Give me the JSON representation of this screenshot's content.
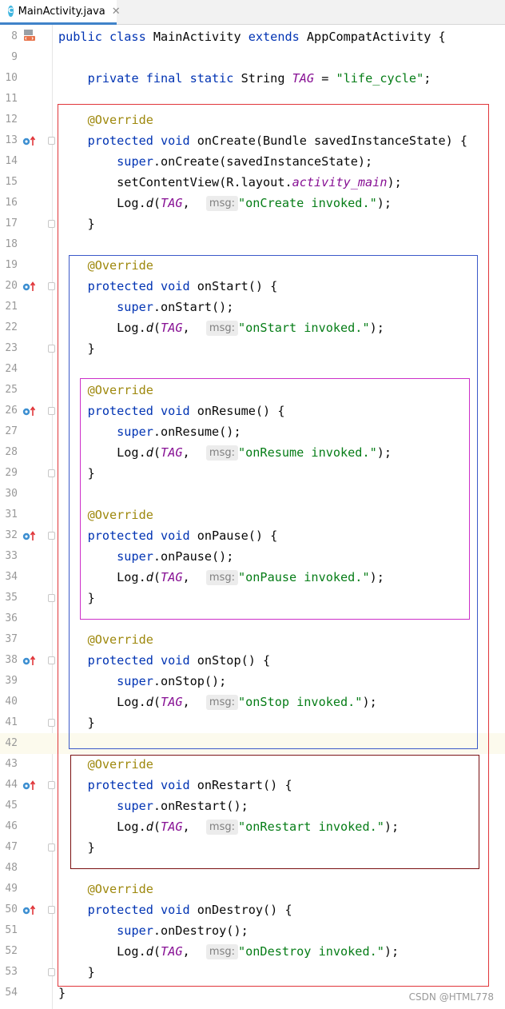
{
  "tab": {
    "icon_letter": "C",
    "filename": "MainActivity.java",
    "close": "✕"
  },
  "watermark": "CSDN @HTML778",
  "colors": {
    "red_box": "#e0363a",
    "blue_box": "#3b59c9",
    "magenta_box": "#cc2fc9",
    "dark_red_box": "#7a0f10"
  },
  "lines": [
    {
      "n": "8",
      "code": [
        [
          "kw",
          "public class "
        ],
        [
          "",
          "MainActivity "
        ],
        [
          "kw",
          "extends "
        ],
        [
          "",
          "AppCompatActivity {"
        ]
      ],
      "marker": "layout"
    },
    {
      "n": "9",
      "code": []
    },
    {
      "n": "10",
      "code": [
        [
          "",
          "    "
        ],
        [
          "kw",
          "private final static "
        ],
        [
          "",
          "String "
        ],
        [
          "fld",
          "TAG"
        ],
        [
          "",
          " = "
        ],
        [
          "str",
          "\"life_cycle\""
        ],
        [
          "",
          ";"
        ]
      ]
    },
    {
      "n": "11",
      "code": []
    },
    {
      "n": "12",
      "code": [
        [
          "",
          "    "
        ],
        [
          "ann",
          "@Override"
        ]
      ]
    },
    {
      "n": "13",
      "code": [
        [
          "",
          "    "
        ],
        [
          "kw",
          "protected void "
        ],
        [
          "",
          "onCreate(Bundle savedInstanceState) {"
        ]
      ],
      "marker": "override",
      "fold": true
    },
    {
      "n": "14",
      "code": [
        [
          "",
          "        "
        ],
        [
          "kw",
          "super"
        ],
        [
          "",
          ".onCreate(savedInstanceState);"
        ]
      ]
    },
    {
      "n": "15",
      "code": [
        [
          "",
          "        "
        ],
        [
          "",
          "setContentView(R.layout."
        ],
        [
          "fld",
          "activity_main"
        ],
        [
          "",
          ");"
        ]
      ]
    },
    {
      "n": "16",
      "code": [
        [
          "",
          "        Log."
        ],
        [
          "st",
          "d"
        ],
        [
          "",
          "("
        ],
        [
          "fld",
          "TAG"
        ],
        [
          "",
          ",  "
        ],
        [
          "hint",
          "msg:"
        ],
        [
          "str",
          "\"onCreate invoked.\""
        ],
        [
          "",
          ");"
        ]
      ]
    },
    {
      "n": "17",
      "code": [
        [
          "",
          "    }"
        ]
      ],
      "fold": true
    },
    {
      "n": "18",
      "code": []
    },
    {
      "n": "19",
      "code": [
        [
          "",
          "    "
        ],
        [
          "ann",
          "@Override"
        ]
      ]
    },
    {
      "n": "20",
      "code": [
        [
          "",
          "    "
        ],
        [
          "kw",
          "protected void "
        ],
        [
          "",
          "onStart() {"
        ]
      ],
      "marker": "override",
      "fold": true
    },
    {
      "n": "21",
      "code": [
        [
          "",
          "        "
        ],
        [
          "kw",
          "super"
        ],
        [
          "",
          ".onStart();"
        ]
      ]
    },
    {
      "n": "22",
      "code": [
        [
          "",
          "        Log."
        ],
        [
          "st",
          "d"
        ],
        [
          "",
          "("
        ],
        [
          "fld",
          "TAG"
        ],
        [
          "",
          ",  "
        ],
        [
          "hint",
          "msg:"
        ],
        [
          "str",
          "\"onStart invoked.\""
        ],
        [
          "",
          ");"
        ]
      ]
    },
    {
      "n": "23",
      "code": [
        [
          "",
          "    }"
        ]
      ],
      "fold": true
    },
    {
      "n": "24",
      "code": []
    },
    {
      "n": "25",
      "code": [
        [
          "",
          "    "
        ],
        [
          "ann",
          "@Override"
        ]
      ]
    },
    {
      "n": "26",
      "code": [
        [
          "",
          "    "
        ],
        [
          "kw",
          "protected void "
        ],
        [
          "",
          "onResume() {"
        ]
      ],
      "marker": "override",
      "fold": true
    },
    {
      "n": "27",
      "code": [
        [
          "",
          "        "
        ],
        [
          "kw",
          "super"
        ],
        [
          "",
          ".onResume();"
        ]
      ]
    },
    {
      "n": "28",
      "code": [
        [
          "",
          "        Log."
        ],
        [
          "st",
          "d"
        ],
        [
          "",
          "("
        ],
        [
          "fld",
          "TAG"
        ],
        [
          "",
          ",  "
        ],
        [
          "hint",
          "msg:"
        ],
        [
          "str",
          "\"onResume invoked.\""
        ],
        [
          "",
          ");"
        ]
      ]
    },
    {
      "n": "29",
      "code": [
        [
          "",
          "    }"
        ]
      ],
      "fold": true
    },
    {
      "n": "30",
      "code": []
    },
    {
      "n": "31",
      "code": []
    },
    {
      "n": "32",
      "code": [
        [
          "",
          "    "
        ],
        [
          "kw",
          "protected void "
        ],
        [
          "",
          "onPause() {"
        ]
      ],
      "marker": "override",
      "fold": true
    },
    {
      "n": "33",
      "code": [
        [
          "",
          "        "
        ],
        [
          "kw",
          "super"
        ],
        [
          "",
          ".onPause();"
        ]
      ]
    },
    {
      "n": "34",
      "code": [
        [
          "",
          "        Log."
        ],
        [
          "st",
          "d"
        ],
        [
          "",
          "("
        ],
        [
          "fld",
          "TAG"
        ],
        [
          "",
          ",  "
        ],
        [
          "hint",
          "msg:"
        ],
        [
          "str",
          "\"onPause invoked.\""
        ],
        [
          "",
          ");"
        ]
      ]
    },
    {
      "n": "35",
      "code": [
        [
          "",
          "    }"
        ]
      ],
      "fold": true
    },
    {
      "n": "36",
      "code": []
    },
    {
      "n": "37",
      "code": [
        [
          "",
          "    "
        ],
        [
          "ann",
          "@Override"
        ]
      ]
    },
    {
      "n": "38",
      "code": [
        [
          "",
          "    "
        ],
        [
          "kw",
          "protected void "
        ],
        [
          "",
          "onStop() {"
        ]
      ],
      "marker": "override",
      "fold": true
    },
    {
      "n": "39",
      "code": [
        [
          "",
          "        "
        ],
        [
          "kw",
          "super"
        ],
        [
          "",
          ".onStop();"
        ]
      ]
    },
    {
      "n": "40",
      "code": [
        [
          "",
          "        Log."
        ],
        [
          "st",
          "d"
        ],
        [
          "",
          "("
        ],
        [
          "fld",
          "TAG"
        ],
        [
          "",
          ",  "
        ],
        [
          "hint",
          "msg:"
        ],
        [
          "str",
          "\"onStop invoked.\""
        ],
        [
          "",
          ");"
        ]
      ]
    },
    {
      "n": "41",
      "code": [
        [
          "",
          "    }"
        ]
      ],
      "fold": true
    },
    {
      "n": "42",
      "code": [],
      "current": true
    },
    {
      "n": "43",
      "code": [
        [
          "",
          "    "
        ],
        [
          "ann",
          "@Override"
        ]
      ]
    },
    {
      "n": "44",
      "code": [
        [
          "",
          "    "
        ],
        [
          "kw",
          "protected void "
        ],
        [
          "",
          "onRestart() {"
        ]
      ],
      "marker": "override",
      "fold": true
    },
    {
      "n": "45",
      "code": [
        [
          "",
          "        "
        ],
        [
          "kw",
          "super"
        ],
        [
          "",
          ".onRestart();"
        ]
      ]
    },
    {
      "n": "46",
      "code": [
        [
          "",
          "        Log."
        ],
        [
          "st",
          "d"
        ],
        [
          "",
          "("
        ],
        [
          "fld",
          "TAG"
        ],
        [
          "",
          ",  "
        ],
        [
          "hint",
          "msg:"
        ],
        [
          "str",
          "\"onRestart invoked.\""
        ],
        [
          "",
          ");"
        ]
      ]
    },
    {
      "n": "47",
      "code": [
        [
          "",
          "    }"
        ]
      ],
      "fold": true
    },
    {
      "n": "48",
      "code": []
    },
    {
      "n": "49",
      "code": [
        [
          "",
          "    "
        ],
        [
          "ann",
          "@Override"
        ]
      ]
    },
    {
      "n": "50",
      "code": [
        [
          "",
          "    "
        ],
        [
          "kw",
          "protected void "
        ],
        [
          "",
          "onDestroy() {"
        ]
      ],
      "marker": "override",
      "fold": true
    },
    {
      "n": "51",
      "code": [
        [
          "",
          "        "
        ],
        [
          "kw",
          "super"
        ],
        [
          "",
          ".onDestroy();"
        ]
      ]
    },
    {
      "n": "52",
      "code": [
        [
          "",
          "        Log."
        ],
        [
          "st",
          "d"
        ],
        [
          "",
          "("
        ],
        [
          "fld",
          "TAG"
        ],
        [
          "",
          ",  "
        ],
        [
          "hint",
          "msg:"
        ],
        [
          "str",
          "\"onDestroy invoked.\""
        ],
        [
          "",
          ");"
        ]
      ]
    },
    {
      "n": "53",
      "code": [
        [
          "",
          "    }"
        ]
      ],
      "fold": true
    },
    {
      "n": "54",
      "code": [
        [
          "",
          "}"
        ]
      ]
    }
  ],
  "extra_annotation_line_31": "@Override"
}
